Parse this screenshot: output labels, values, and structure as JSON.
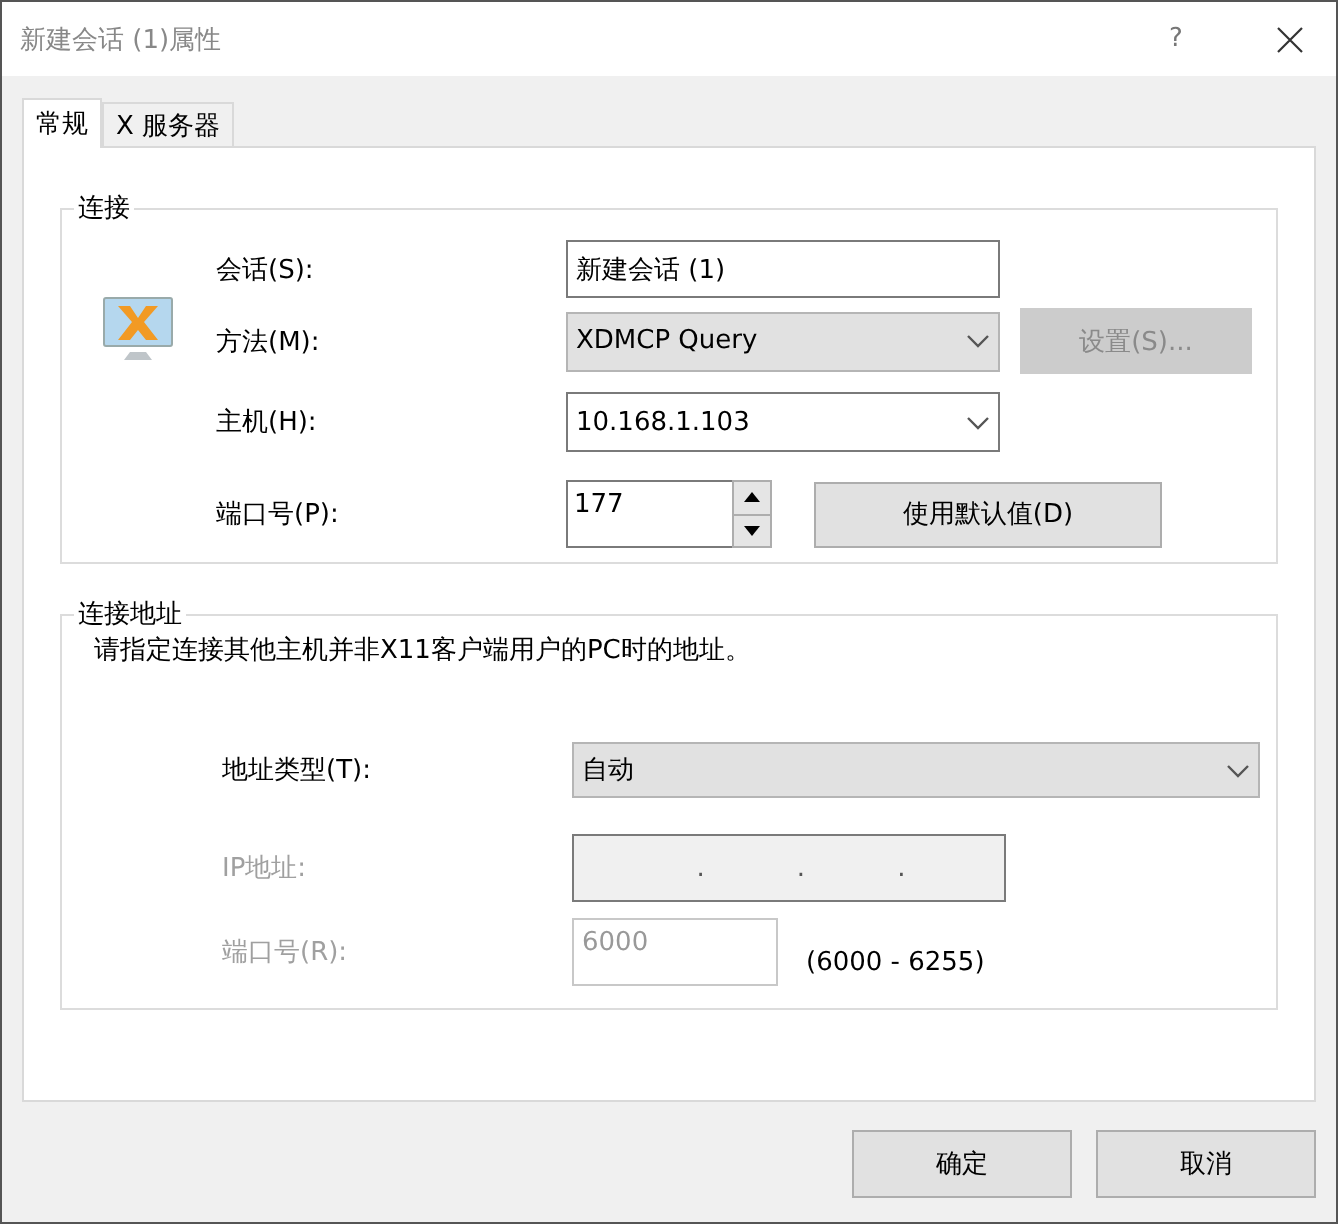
{
  "window": {
    "title": "新建会话 (1)属性",
    "help": "?"
  },
  "tabs": [
    {
      "label": "常规",
      "selected": true
    },
    {
      "label": "X 服务器",
      "selected": false
    }
  ],
  "connection": {
    "legend": "连接",
    "fields": [
      {
        "kind": "text",
        "label": "会话(S):",
        "value": "新建会话 (1)",
        "disabled": false
      },
      {
        "kind": "select",
        "label": "方法(M):",
        "value": "XDMCP Query",
        "disabled": false,
        "button": {
          "label": "设置(S)...",
          "disabled": true
        }
      },
      {
        "kind": "combo",
        "label": "主机(H):",
        "value": "10.168.1.103",
        "disabled": false
      },
      {
        "kind": "spin",
        "label": "端口号(P):",
        "value": "177",
        "disabled": false,
        "button": {
          "label": "使用默认值(D)",
          "disabled": false
        }
      }
    ]
  },
  "address": {
    "legend": "连接地址",
    "description": "请指定连接其他主机并非X11客户端用户的PC时的地址。",
    "fields": [
      {
        "kind": "select",
        "label": "地址类型(T):",
        "value": "自动",
        "disabled": false
      },
      {
        "kind": "ip",
        "label": "IP地址:",
        "separators": [
          ".",
          ".",
          "."
        ],
        "disabled": true
      },
      {
        "kind": "text",
        "label": "端口号(R):",
        "value": "6000",
        "disabled": true,
        "note": "(6000 - 6255)"
      }
    ]
  },
  "buttons": [
    {
      "label": "确定"
    },
    {
      "label": "取消"
    }
  ]
}
